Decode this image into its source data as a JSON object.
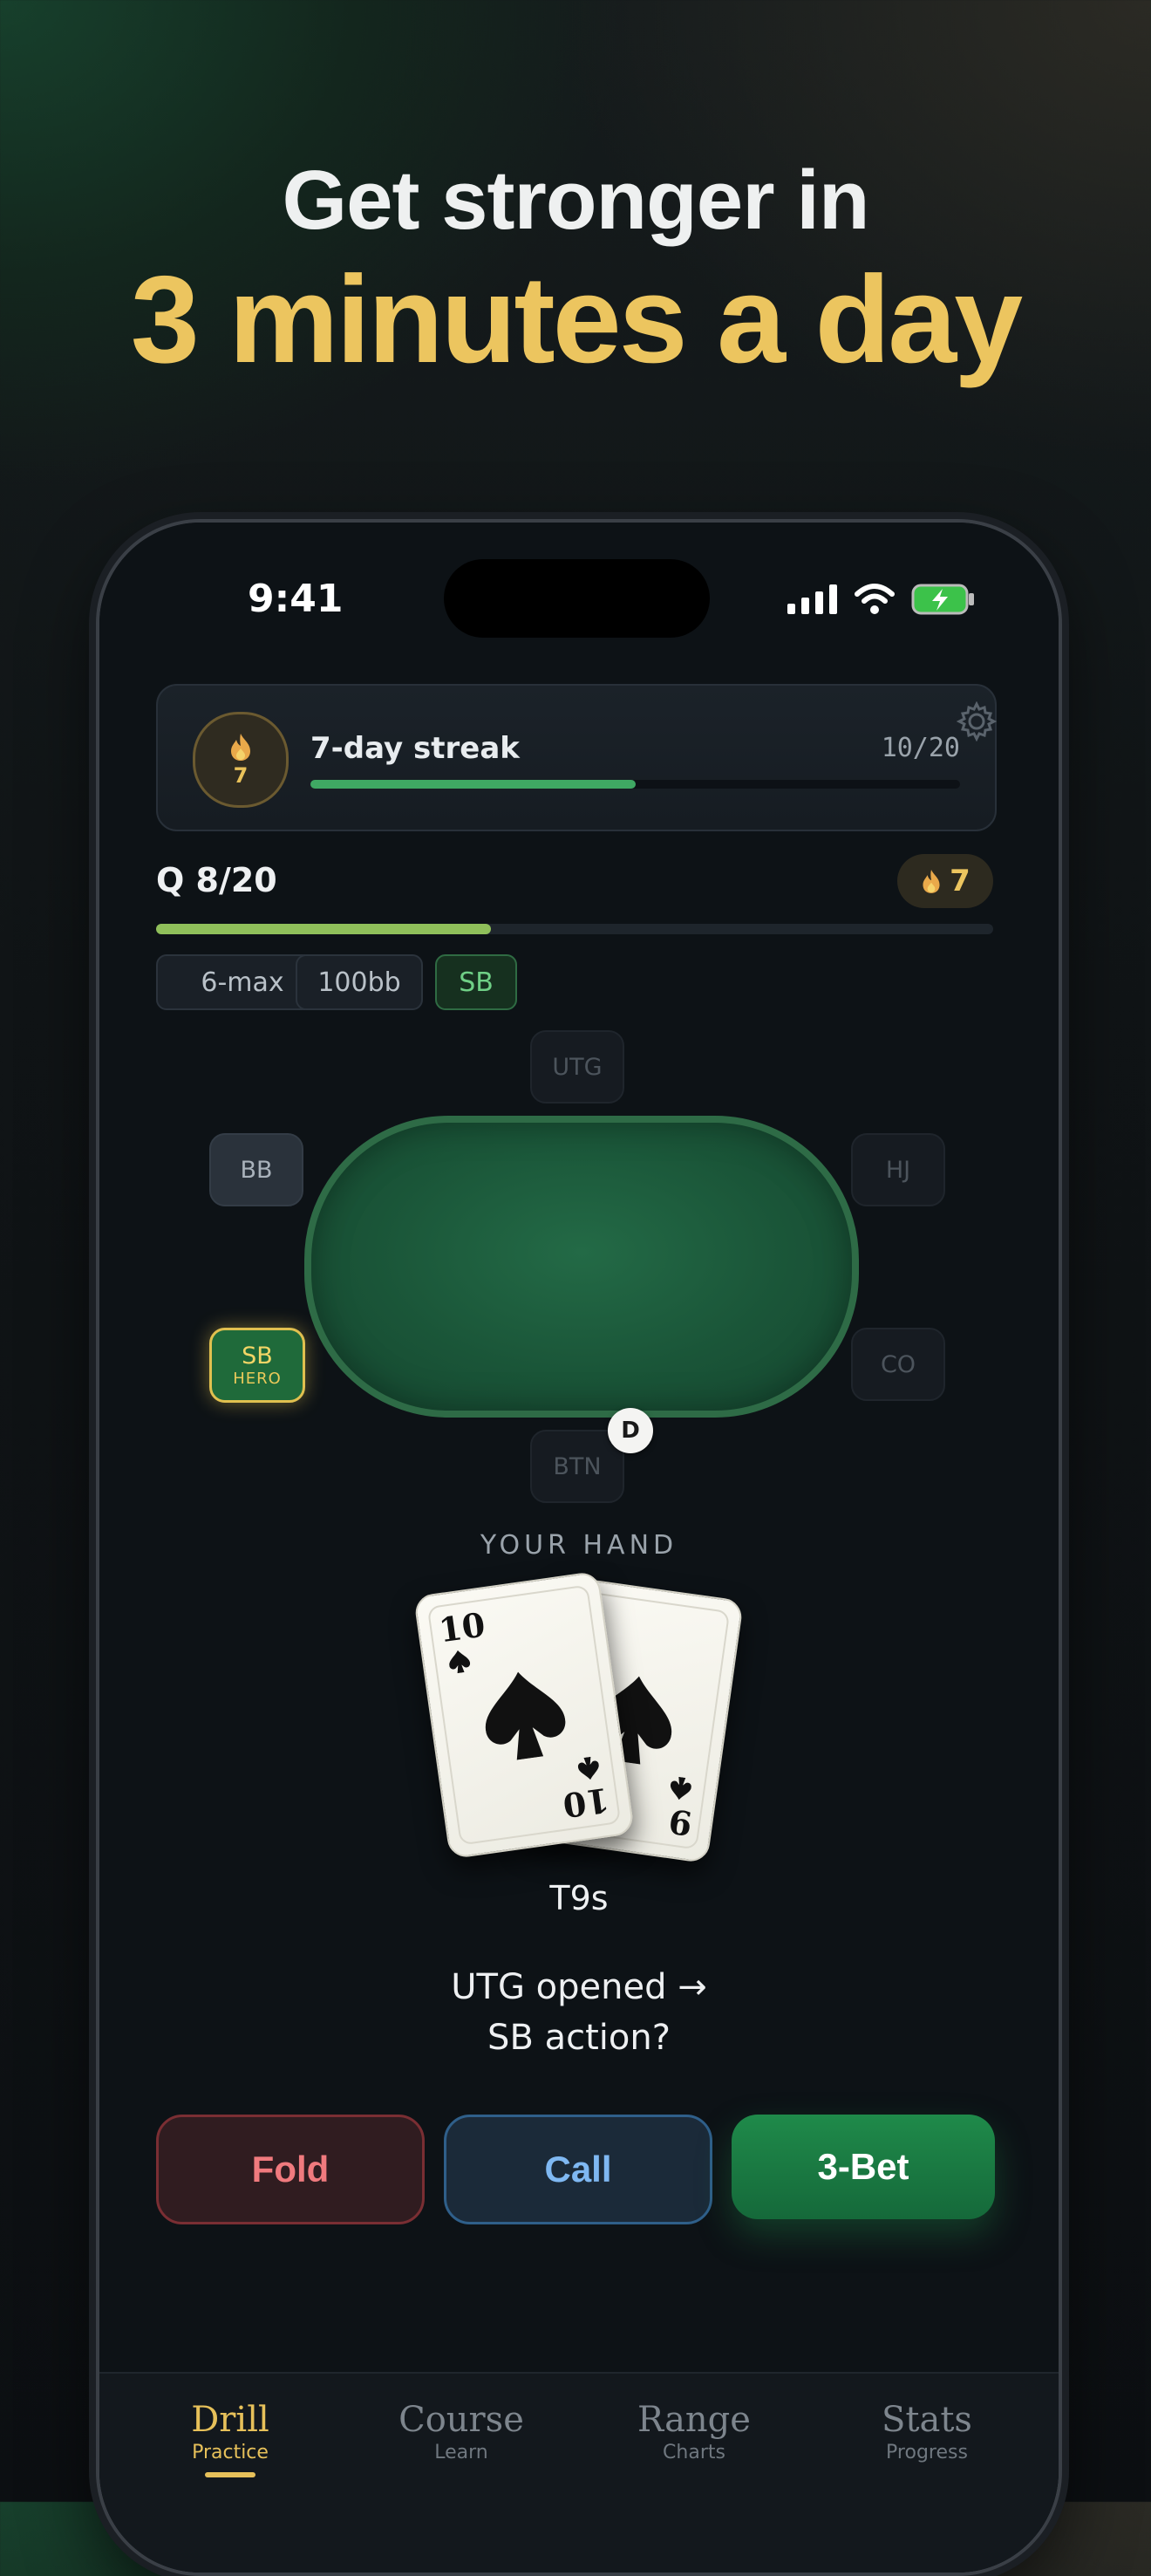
{
  "headline": {
    "line1": "Get stronger in",
    "line2": "3 minutes a day"
  },
  "status_bar": {
    "time": "9:41"
  },
  "streak": {
    "badge_count": "7",
    "title": "7-day streak",
    "progress_text": "10/20",
    "progress": 0.5
  },
  "quiz": {
    "label": "Q 8/20",
    "badge_count": "7",
    "progress": 0.4
  },
  "chips": [
    "6-max",
    "100bb",
    "SB"
  ],
  "seats": {
    "utg": "UTG",
    "hj": "HJ",
    "co": "CO",
    "btn": "BTN",
    "sb": "SB",
    "sb_sub": "HERO",
    "bb": "BB"
  },
  "dealer": "D",
  "hand": {
    "label": "YOUR HAND",
    "card1_rank": "10",
    "card2_rank": "9",
    "name": "T9s"
  },
  "prompt": {
    "line1": "UTG opened →",
    "line2": "SB action?"
  },
  "actions": {
    "fold": "Fold",
    "call": "Call",
    "bet": "3-Bet"
  },
  "tabs": [
    {
      "label": "Drill",
      "sub": "Practice"
    },
    {
      "label": "Course",
      "sub": "Learn"
    },
    {
      "label": "Range",
      "sub": "Charts"
    },
    {
      "label": "Stats",
      "sub": "Progress"
    }
  ],
  "colors": {
    "gold": "#ecc55f",
    "green": "#1f8a4a",
    "fold_red": "#f07a7e",
    "call_blue": "#7fb8f2"
  }
}
